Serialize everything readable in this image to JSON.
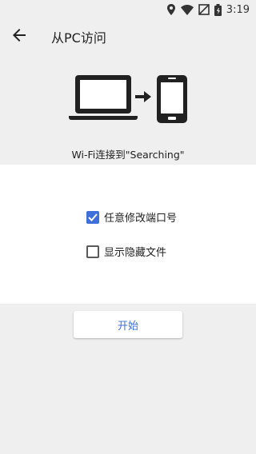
{
  "status_bar": {
    "time": "3:19",
    "icons": [
      "location-icon",
      "wifi-icon",
      "no-sim-icon",
      "battery-icon"
    ]
  },
  "toolbar": {
    "back_icon": "arrow-left-icon",
    "title": "从PC访问"
  },
  "illustration": {
    "icons": [
      "laptop-icon",
      "arrow-right-icon",
      "phone-icon"
    ]
  },
  "connection": {
    "text": "Wi-Fi连接到\"Searching\""
  },
  "options": [
    {
      "label": "任意修改端口号",
      "checked": true
    },
    {
      "label": "显示隐藏文件",
      "checked": false
    }
  ],
  "start_button": {
    "label": "开始"
  },
  "colors": {
    "accent": "#3f6fd8",
    "background": "#efefef",
    "panel": "#ffffff",
    "icon": "#212121"
  }
}
